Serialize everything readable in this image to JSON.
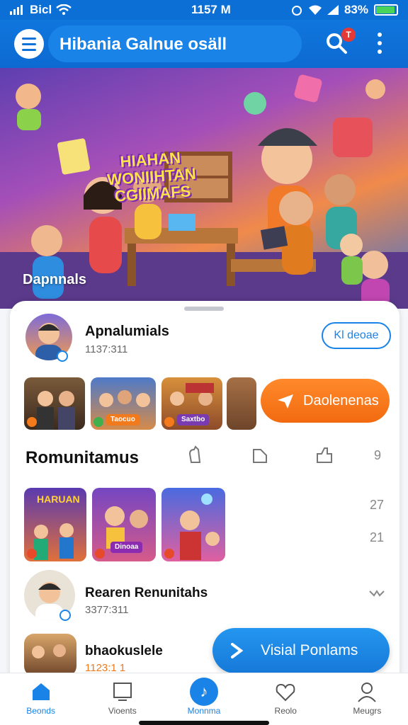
{
  "status_bar": {
    "carrier": "Bicl",
    "time": "1157 M",
    "battery": "83%"
  },
  "app_bar": {
    "title": "Hibania Galnue osäll",
    "notification_count": "T"
  },
  "hero": {
    "title_line1": "HIAHAN",
    "title_line2": "WONIIHTAN",
    "title_line3": "CGIIMAFS",
    "caption": "Dapnnals"
  },
  "profile": {
    "name": "Apnalumials",
    "sub": "1137:311",
    "follow_label": "Kl deoae"
  },
  "thumbs_row1": {
    "items": [
      {
        "tag": ""
      },
      {
        "tag": "Taocuo"
      },
      {
        "tag": "Saxtbo"
      },
      {
        "tag": ""
      }
    ],
    "cta_label": "Daolenenas"
  },
  "section": {
    "title": "Romunitamus",
    "side_num": "9"
  },
  "thumbs_row2": {
    "items": [
      {
        "tag": "HARUAN"
      },
      {
        "tag": "Dinoaa"
      },
      {
        "tag": ""
      }
    ],
    "side_num_1": "27",
    "side_num_2": "21"
  },
  "list_item_1": {
    "name": "Rearen Renunitahs",
    "sub": "3377:311"
  },
  "list_item_2": {
    "name": "bhaokuslele",
    "sub": "1123:1 1"
  },
  "fab": {
    "label": "Visial Ponlams"
  },
  "bottom_nav": [
    {
      "label": "Beonds"
    },
    {
      "label": "Vioents"
    },
    {
      "label": "Monnma"
    },
    {
      "label": "Reolo"
    },
    {
      "label": "Meugrs"
    }
  ],
  "colors": {
    "primary": "#0f72d8",
    "accent_orange": "#f57a1c",
    "accent_blue": "#1a83e8"
  }
}
